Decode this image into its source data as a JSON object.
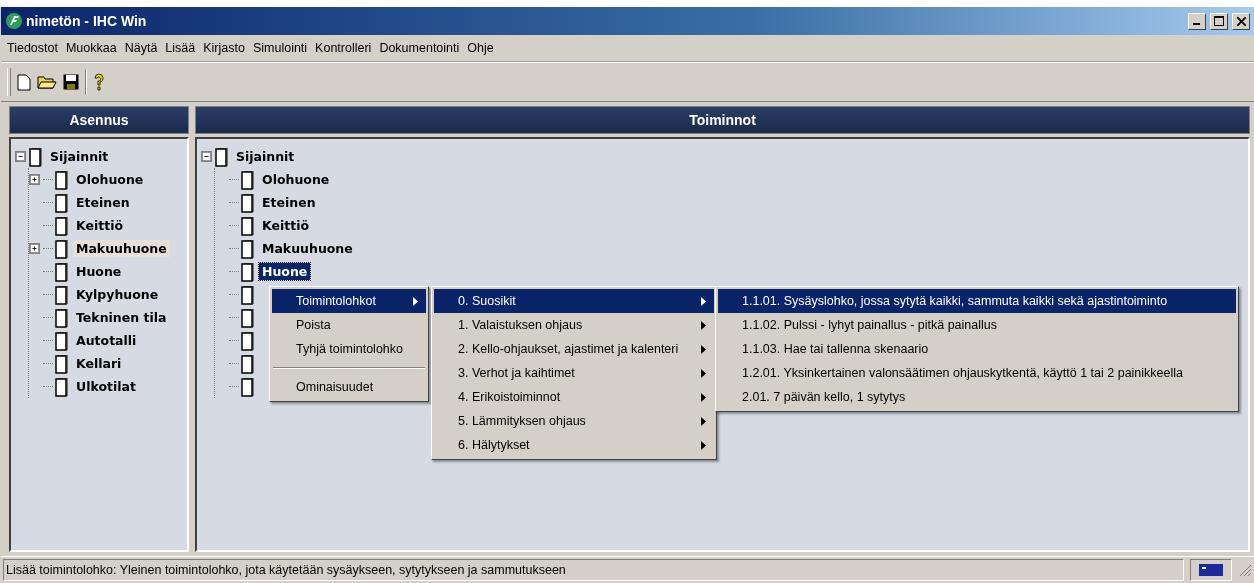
{
  "window": {
    "title": "nimetön - IHC Win"
  },
  "menu_bar": [
    "Tiedostot",
    "Muokkaa",
    "Näytä",
    "Lisää",
    "Kirjasto",
    "Simulointi",
    "Kontrolleri",
    "Dokumentointi",
    "Ohje"
  ],
  "left_panel": {
    "title": "Asennus",
    "tree": [
      {
        "label": "Sijainnit",
        "expanded": true,
        "children": [
          {
            "label": "Olohuone",
            "expandable": true,
            "hot": false
          },
          {
            "label": "Eteinen",
            "expandable": false,
            "hot": false
          },
          {
            "label": "Keittiö",
            "expandable": false,
            "hot": false
          },
          {
            "label": "Makuuhuone",
            "expandable": true,
            "hot": true
          },
          {
            "label": "Huone",
            "expandable": false,
            "hot": false
          },
          {
            "label": "Kylpyhuone",
            "expandable": false,
            "hot": false
          },
          {
            "label": "Tekninen tila",
            "expandable": false,
            "hot": false
          },
          {
            "label": "Autotalli",
            "expandable": false,
            "hot": false
          },
          {
            "label": "Kellari",
            "expandable": false,
            "hot": false
          },
          {
            "label": "Ulkotilat",
            "expandable": false,
            "hot": false
          }
        ]
      }
    ]
  },
  "right_panel": {
    "title": "Toiminnot",
    "tree": [
      {
        "label": "Sijainnit",
        "expanded": true,
        "children": [
          {
            "kind": "item",
            "label": "Olohuone",
            "selected": false
          },
          {
            "kind": "item",
            "label": "Eteinen",
            "selected": false
          },
          {
            "kind": "item",
            "label": "Keittiö",
            "selected": false
          },
          {
            "kind": "item",
            "label": "Makuuhuone",
            "selected": false
          },
          {
            "kind": "item",
            "label": "Huone",
            "selected": true
          },
          {
            "kind": "covered"
          },
          {
            "kind": "covered"
          },
          {
            "kind": "covered"
          },
          {
            "kind": "covered"
          },
          {
            "kind": "covered"
          }
        ]
      }
    ]
  },
  "context_menu": [
    {
      "label": "Toimintolohkot",
      "submenu": true,
      "selected": true
    },
    {
      "label": "Poista",
      "submenu": false,
      "selected": false
    },
    {
      "label": "Tyhjä toimintolohko",
      "submenu": false,
      "selected": false
    },
    {
      "kind": "separator"
    },
    {
      "label": "Ominaisuudet",
      "submenu": false,
      "selected": false
    }
  ],
  "submenu": [
    {
      "label": "0. Suosikit",
      "selected": true
    },
    {
      "label": "1. Valaistuksen ohjaus",
      "selected": false
    },
    {
      "label": "2. Kello-ohjaukset, ajastimet ja kalenteri",
      "selected": false
    },
    {
      "label": "3. Verhot ja kaihtimet",
      "selected": false
    },
    {
      "label": "4. Erikoistoiminnot",
      "selected": false
    },
    {
      "label": "5. Lämmityksen ohjaus",
      "selected": false
    },
    {
      "label": "6. Hälytykset",
      "selected": false
    }
  ],
  "favorites_menu": [
    {
      "label": "1.1.01. Sysäyslohko, jossa sytytä kaikki, sammuta kaikki sekä ajastintoiminto",
      "selected": true
    },
    {
      "label": "1.1.02. Pulssi - lyhyt painallus - pitkä painallus",
      "selected": false
    },
    {
      "label": "1.1.03. Hae tai tallenna skenaario",
      "selected": false
    },
    {
      "label": "1.2.01. Yksinkertainen valonsäätimen ohjauskytkentä, käyttö 1 tai 2 painikkeella",
      "selected": false
    },
    {
      "label": "2.01. 7 päivän kello, 1 sytytys",
      "selected": false
    }
  ],
  "status_bar": {
    "text": "Lisää toimintolohko: Yleinen toimintolohko, jota käytetään sysäykseen, sytytykseen ja sammutukseen"
  }
}
